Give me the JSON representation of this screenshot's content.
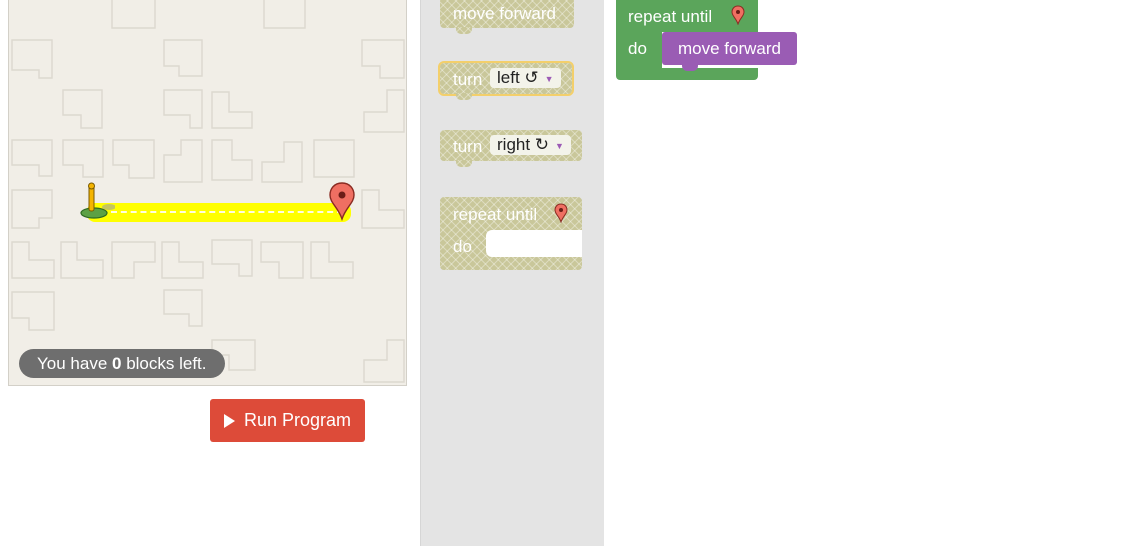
{
  "maze": {
    "blocks_left_prefix": "You have ",
    "blocks_left_count": "0",
    "blocks_left_suffix": " blocks left."
  },
  "run_button": {
    "label": "Run Program",
    "icon": "play-icon"
  },
  "toolbox": {
    "move_forward": "move forward",
    "turn_left": {
      "label": "turn",
      "value": "left ↺"
    },
    "turn_right": {
      "label": "turn",
      "value": "right ↻"
    },
    "repeat_until": {
      "label": "repeat until",
      "do": "do",
      "icon": "marker-icon"
    }
  },
  "workspace": {
    "repeat_until": "repeat until",
    "do": "do",
    "move_forward": "move forward"
  },
  "colors": {
    "path": "#ffff00",
    "run_button": "#dd4b39",
    "loop_block": "#5ba55b",
    "move_block": "#9a5cb4",
    "disabled_block": "#c9c79a"
  }
}
